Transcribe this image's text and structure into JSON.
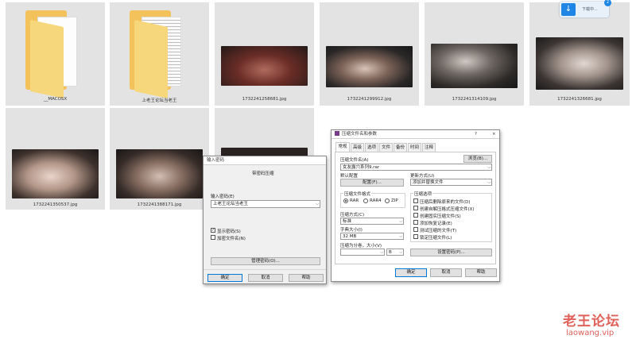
{
  "files": [
    {
      "name": "__MACOSX",
      "kind": "folder"
    },
    {
      "name": "上老王论坛当老王",
      "kind": "folder"
    },
    {
      "name": "1732241258681.jpg",
      "kind": "image"
    },
    {
      "name": "1732241299912.jpg",
      "kind": "image"
    },
    {
      "name": "1732241314109.jpg",
      "kind": "image"
    },
    {
      "name": "1732241326681.jpg",
      "kind": "image"
    },
    {
      "name": "1732241350537.jpg",
      "kind": "image"
    },
    {
      "name": "1732241388171.jpg",
      "kind": "image"
    }
  ],
  "download_widget": {
    "label": "下载中...",
    "count": "2"
  },
  "password_dialog": {
    "title": "输入密码",
    "heading": "带密码压缩",
    "password_label": "输入密码(E)",
    "password_value": "上老王论坛当老王",
    "show_password": "显示密码(S)",
    "encrypt_filenames": "加密文件名(N)",
    "manage_button": "管理密码(O)...",
    "ok": "确定",
    "cancel": "取消",
    "help": "帮助"
  },
  "archive_dialog": {
    "title": "压缩文件名和参数",
    "help_icon": "?",
    "tabs": [
      "常规",
      "高级",
      "选项",
      "文件",
      "备份",
      "时间",
      "注释"
    ],
    "archive_name_label": "压缩文件名(A)",
    "archive_name_value": "女友露穴系列9.rar",
    "browse_button": "浏览(B)...",
    "default_profile_label": "默认配置",
    "profiles_button": "配置(F)...",
    "update_mode_label": "更新方式(U)",
    "update_mode_value": "添加并替换文件",
    "format_label": "压缩文件格式",
    "formats": [
      "RAR",
      "RAR4",
      "ZIP"
    ],
    "method_label": "压缩方式(C)",
    "method_value": "标准",
    "dict_label": "字典大小(I)",
    "dict_value": "32 MB",
    "split_label": "压缩为分卷，大小(V)",
    "split_unit": "B",
    "options_label": "压缩选项",
    "options": [
      "压缩后删除原来的文件(D)",
      "创建自解压格式压缩文件(X)",
      "创建固实压缩文件(S)",
      "添加恢复记录(E)",
      "测试压缩的文件(T)",
      "锁定压缩文件(L)"
    ],
    "set_password_button": "设置密码(P)...",
    "ok": "确定",
    "cancel": "取消",
    "help": "帮助"
  },
  "watermark": {
    "line1": "老王论坛",
    "line2": "laowang.vip"
  }
}
